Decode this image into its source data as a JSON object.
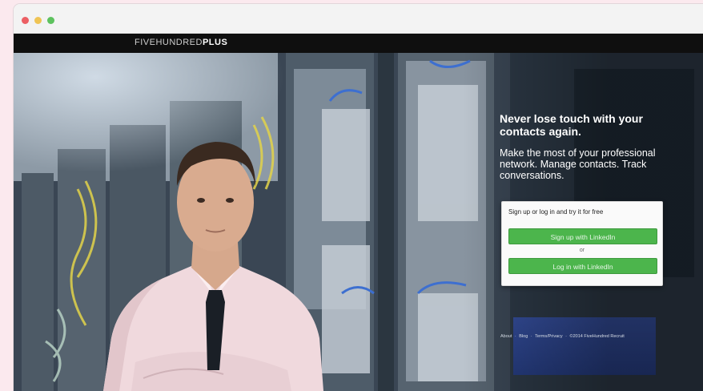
{
  "brand": {
    "prefix": "FIVEHUNDRED",
    "suffix": "PLUS"
  },
  "hero": {
    "headline": "Never lose touch with your contacts again.",
    "subtext": "Make the most of your professional network. Manage contacts. Track conversations."
  },
  "signup_panel": {
    "heading": "Sign up or log in and try it for free",
    "signup_label": "Sign up with LinkedIn",
    "or_label": "or",
    "login_label": "Log in with LinkedIn"
  },
  "footer": {
    "links": [
      "About",
      "Blog",
      "Terms/Privacy",
      "©2014 FiveHundred Recruit"
    ],
    "separator": "·"
  },
  "colors": {
    "accent_green": "#4cb54c",
    "navbar": "#0f0f0f",
    "window_bg": "#fbe9ee"
  }
}
